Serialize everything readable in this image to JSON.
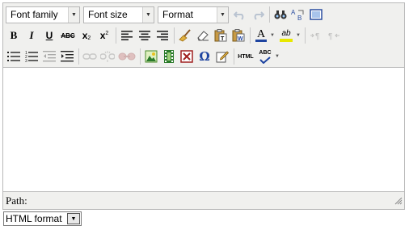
{
  "toolbar": {
    "font_family": "Font family",
    "font_size": "Font size",
    "format": "Format",
    "bold": "B",
    "italic": "I",
    "underline": "U",
    "strikethrough": "ABC",
    "subscript": "x",
    "superscript": "x",
    "html": "HTML",
    "spellcheck": "ABC",
    "font_color": "A",
    "highlight": "ab"
  },
  "statusbar": {
    "path": "Path:"
  },
  "format_select": {
    "value": "HTML format"
  },
  "colors": {
    "toolbar_bg": "#f0f0ee",
    "border": "#b9b9b9",
    "accent": "#1e44a0"
  }
}
